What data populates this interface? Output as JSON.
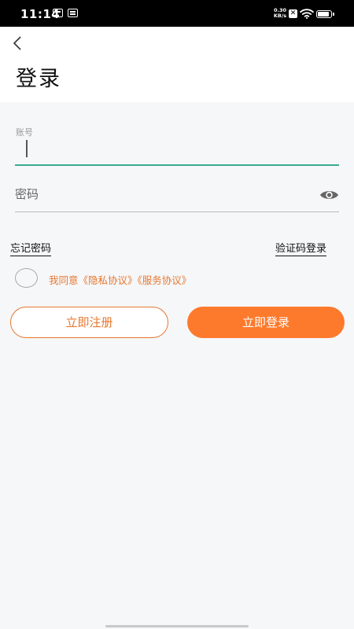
{
  "status_bar": {
    "time": "11:14",
    "net_speed_value": "0.30",
    "net_speed_unit": "KB/s",
    "sim_icon_glyph": "✕",
    "battery_level": 0.9
  },
  "header": {
    "title": "登录"
  },
  "form": {
    "account_label": "账号",
    "account_value": "",
    "password_placeholder": "密码",
    "password_value": ""
  },
  "links": {
    "forgot_password": "忘记密码",
    "sms_login": "验证码登录"
  },
  "agreement": {
    "checked": false,
    "prefix": "我同意",
    "privacy": "《隐私协议》",
    "service": "《服务协议》"
  },
  "buttons": {
    "register": "立即注册",
    "login": "立即登录"
  },
  "colors": {
    "accent": "#fd7a2d",
    "accent_text": "#e8772e",
    "active_underline": "#3cab8f"
  },
  "icons": {
    "back": "chevron-left-icon",
    "password_toggle": "eye-icon"
  }
}
